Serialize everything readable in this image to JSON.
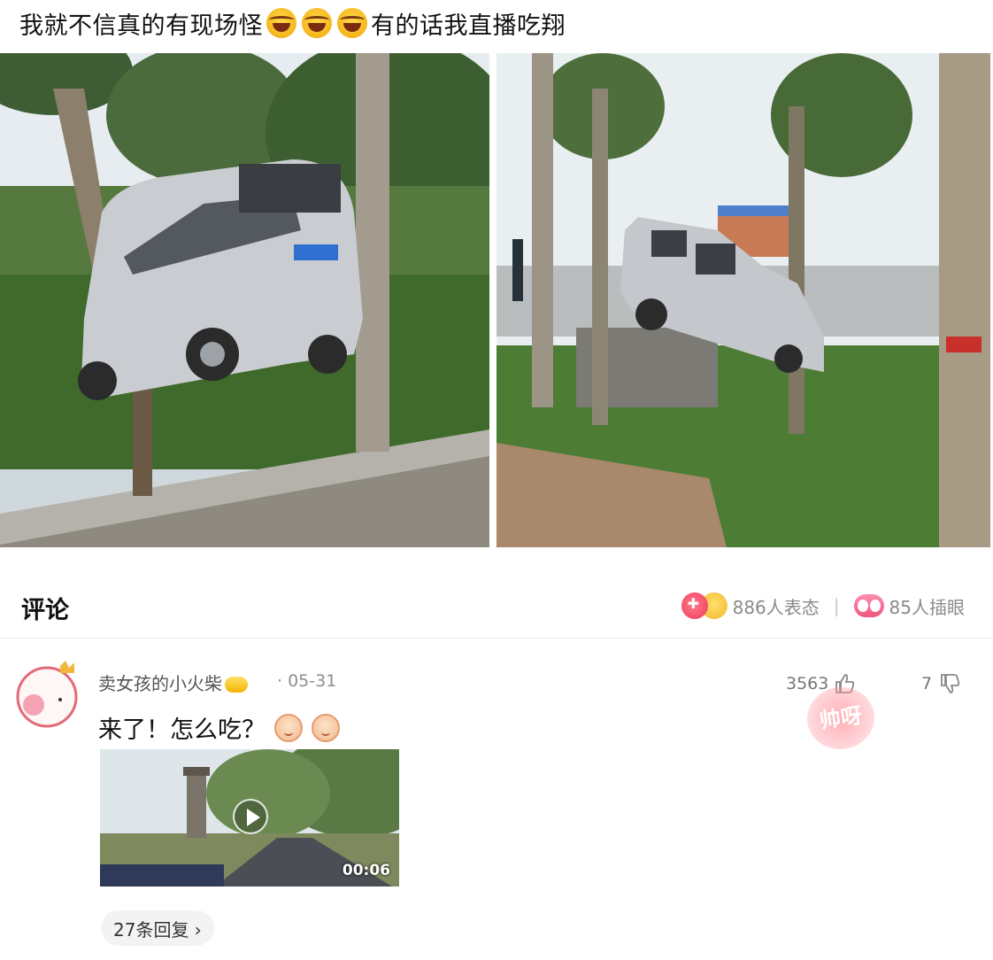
{
  "post": {
    "title_before_emoji": "我就不信真的有现场怪",
    "title_after_emoji": "有的话我直播吃翔",
    "title_emojis": [
      "laughing-emoji",
      "laughing-emoji",
      "laughing-emoji"
    ]
  },
  "comments_section": {
    "title": "评论",
    "reactions_text": "886人表态",
    "eye_roll_text": "85人插眼"
  },
  "comment": {
    "username": "卖女孩的小火柴",
    "date": "· 05-31",
    "like_count": "3563",
    "reply_count": "7",
    "text": "来了！怎么吃？",
    "video_duration": "00:06",
    "replies_button": "27条回复 ›",
    "watermark": "帅呀"
  },
  "icons": {
    "like": "thumbs-up-icon",
    "dislike": "thumbs-down-icon",
    "play": "play-icon"
  }
}
